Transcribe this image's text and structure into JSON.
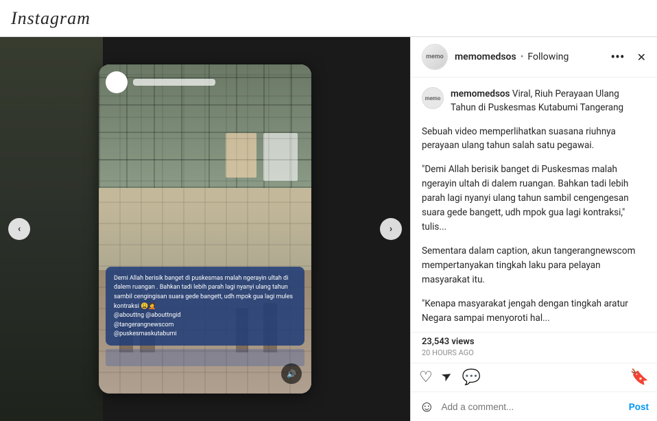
{
  "app": {
    "logo": "Instagram"
  },
  "post": {
    "username": "memomedsos",
    "follow_status": "Following",
    "caption_title": "Viral, Riuh Perayaan Ulang Tahun di Puskesmas Kutabumi Tangerang",
    "body_1": "Sebuah video memperlihatkan suasana riuhnya perayaan ulang tahun salah satu pegawai.",
    "quote_1": "\"Demi Allah berisik banget di Puskesmas malah ngerayin ultah di dalem ruangan. Bahkan tadi lebih parah lagi nyanyi ulang tahun sambil cengengesan suara gede bangett, udh mpok gua lagi kontraksi,\" tulis...",
    "body_2": "Sementara dalam caption, akun tangerangnewscom mempertanyakan tingkah laku para pelayan masyarakat itu.",
    "quote_2": "\"Kenapa masyarakat jengah dengan tingkah aratur Negara sampai menyoroti hal...",
    "views": "23,543 views",
    "timestamp": "20 Hours Ago",
    "comment_placeholder": "Add a comment...",
    "post_button": "Post"
  },
  "phone_overlay": {
    "text": "Demi Allah berisik banget di puskesmas malah ngerayin ultah di dalem ruangan . Bahkan tadi lebih parah lagi nyanyi ulang tahun sambil cengingisan suara gede bangett, udh mpok gua lagi mules kontraksi 😩🤦\n@abouttng @abouttngid\n@tangerangnewscom\n@puskesmaskutabumi"
  },
  "icons": {
    "more": "•••",
    "close": "✕",
    "left_arrow": "‹",
    "right_arrow": "›",
    "heart": "♡",
    "send": "➤",
    "bookmark": "🔖",
    "comment": "💬",
    "sound": "🔊",
    "emoji": "☺"
  }
}
